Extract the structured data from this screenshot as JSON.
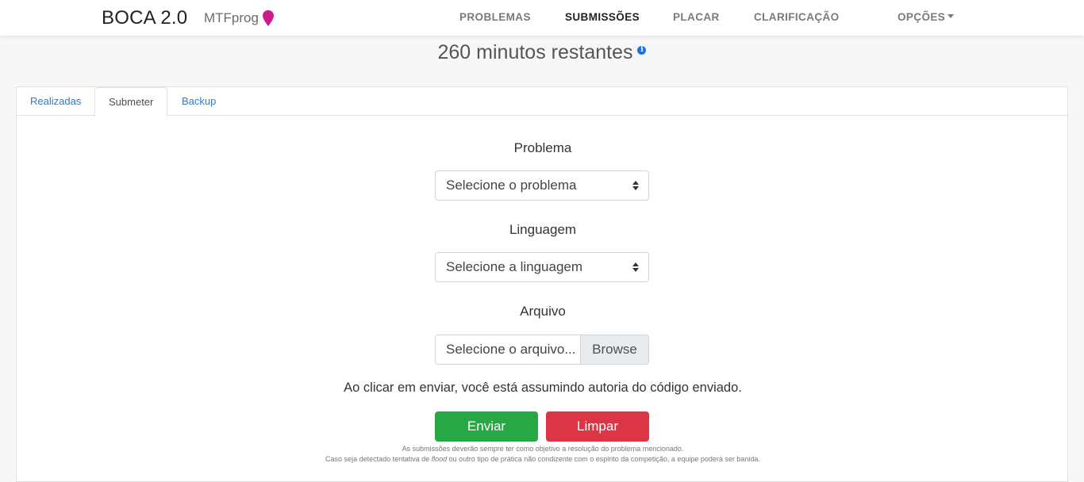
{
  "header": {
    "brand": "BOCA 2.0",
    "contest": "MTFprog",
    "nav": {
      "problems": "PROBLEMAS",
      "submissions": "SUBMISSÕES",
      "scoreboard": "PLACAR",
      "clarification": "CLARIFICAÇÃO",
      "options": "OPÇÕES"
    },
    "pin_color": "#cc1a8f"
  },
  "timer": {
    "text": "260 minutos restantes",
    "info_glyph": "i"
  },
  "tabs": {
    "realizadas": "Realizadas",
    "submeter": "Submeter",
    "backup": "Backup",
    "active": "Submeter"
  },
  "form": {
    "problem_label": "Problema",
    "problem_select": "Selecione o problema",
    "language_label": "Linguagem",
    "language_select": "Selecione a linguagem",
    "file_label": "Arquivo",
    "file_placeholder": "Selecione o arquivo...",
    "browse": "Browse",
    "authorship_notice": "Ao clicar em enviar, você está assumindo autoria do código enviado.",
    "send_button": "Enviar",
    "clear_button": "Limpar",
    "fine_print_1": "As submissões deverão sempre ter como objetivo a resolução do problema mencionado.",
    "fine_print_2_pre": "Caso seja detectado tentativa de ",
    "fine_print_2_em": "flood",
    "fine_print_2_post": " ou outro tipo de prática não condizente com o espirito da competição, a equipe poderá ser banida."
  },
  "colors": {
    "send": "#28a745",
    "clear": "#dc3545",
    "tab_link": "#2b7cd3",
    "info": "#1a73e8"
  }
}
